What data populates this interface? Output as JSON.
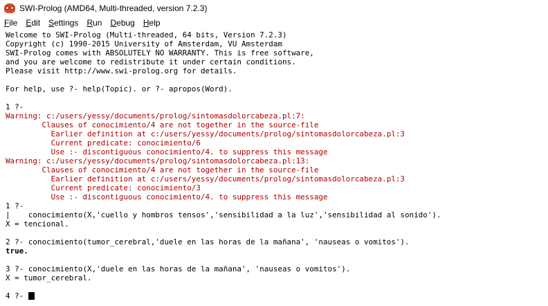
{
  "window": {
    "title": "SWI-Prolog (AMD64, Multi-threaded, version 7.2.3)",
    "icon": "swi-prolog-owl-icon"
  },
  "menu": [
    {
      "u": "F",
      "rest": "ile"
    },
    {
      "u": "E",
      "rest": "dit"
    },
    {
      "u": "S",
      "rest": "ettings"
    },
    {
      "u": "R",
      "rest": "un"
    },
    {
      "u": "D",
      "rest": "ebug"
    },
    {
      "u": "H",
      "rest": "elp"
    }
  ],
  "colors": {
    "warning": "#b00000",
    "text": "#000000",
    "background": "#ffffff"
  },
  "console": {
    "lines": [
      {
        "text": "Welcome to SWI-Prolog (Multi-threaded, 64 bits, Version 7.2.3)",
        "style": "normal"
      },
      {
        "text": "Copyright (c) 1990-2015 University of Amsterdam, VU Amsterdam",
        "style": "normal"
      },
      {
        "text": "SWI-Prolog comes with ABSOLUTELY NO WARRANTY. This is free software,",
        "style": "normal"
      },
      {
        "text": "and you are welcome to redistribute it under certain conditions.",
        "style": "normal"
      },
      {
        "text": "Please visit http://www.swi-prolog.org for details.",
        "style": "normal"
      },
      {
        "text": "",
        "style": "normal"
      },
      {
        "text": "For help, use ?- help(Topic). or ?- apropos(Word).",
        "style": "normal"
      },
      {
        "text": "",
        "style": "normal"
      },
      {
        "text": "1 ?-",
        "style": "normal"
      },
      {
        "text": "Warning: c:/users/yessy/documents/prolog/sintomasdolorcabeza.pl:7:",
        "style": "red"
      },
      {
        "text": "        Clauses of conocimiento/4 are not together in the source-file",
        "style": "red"
      },
      {
        "text": "          Earlier definition at c:/users/yessy/documents/prolog/sintomasdolorcabeza.pl:3",
        "style": "red"
      },
      {
        "text": "          Current predicate: conocimiento/6",
        "style": "red"
      },
      {
        "text": "          Use :- discontiguous conocimiento/4. to suppress this message",
        "style": "red"
      },
      {
        "text": "Warning: c:/users/yessy/documents/prolog/sintomasdolorcabeza.pl:13:",
        "style": "red"
      },
      {
        "text": "        Clauses of conocimiento/4 are not together in the source-file",
        "style": "red"
      },
      {
        "text": "          Earlier definition at c:/users/yessy/documents/prolog/sintomasdolorcabeza.pl:3",
        "style": "red"
      },
      {
        "text": "          Current predicate: conocimiento/3",
        "style": "red"
      },
      {
        "text": "          Use :- discontiguous conocimiento/4. to suppress this message",
        "style": "red"
      },
      {
        "text": "1 ?-",
        "style": "normal"
      },
      {
        "text": "|    conocimiento(X,'cuello y hombros tensos','sensibilidad a la luz','sensibilidad al sonido').",
        "style": "normal"
      },
      {
        "text": "X = tencional.",
        "style": "normal"
      },
      {
        "text": "",
        "style": "normal"
      },
      {
        "text": "2 ?- conocimiento(tumor_cerebral,'duele en las horas de la mañana', 'nauseas o vomitos').",
        "style": "normal"
      },
      {
        "text": "true.",
        "style": "bold"
      },
      {
        "text": "",
        "style": "normal"
      },
      {
        "text": "3 ?- conocimiento(X,'duele en las horas de la mañana', 'nauseas o vomitos').",
        "style": "normal"
      },
      {
        "text": "X = tumor_cerebral.",
        "style": "normal"
      },
      {
        "text": "",
        "style": "normal"
      },
      {
        "text": "4 ?- ",
        "style": "normal"
      }
    ]
  }
}
